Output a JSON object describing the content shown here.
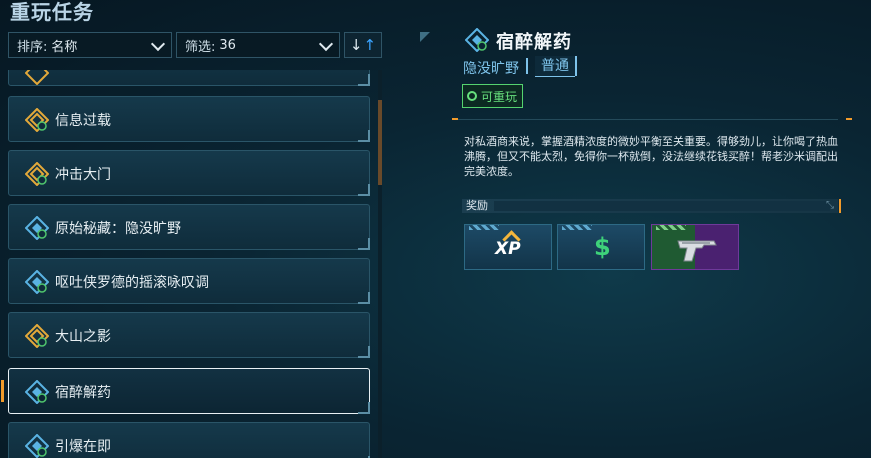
{
  "page": {
    "title": "重玩任务"
  },
  "sort": {
    "label": "排序:",
    "value": "名称"
  },
  "filter": {
    "label": "筛选:",
    "value": "36"
  },
  "sort_direction": {
    "down": "↓",
    "up": "↑"
  },
  "missions": [
    {
      "label": "信息过载",
      "icon": "gold-mission-icon",
      "selected": false
    },
    {
      "label": "冲击大门",
      "icon": "gold-mission-icon",
      "selected": false
    },
    {
      "label": "原始秘藏：隐没旷野",
      "icon": "blue-mission-icon",
      "selected": false
    },
    {
      "label": "呕吐侠罗德的摇滚咏叹调",
      "icon": "blue-mission-icon",
      "selected": false
    },
    {
      "label": "大山之影",
      "icon": "gold-mission-icon",
      "selected": false
    },
    {
      "label": "宿醉解药",
      "icon": "blue-mission-icon",
      "selected": true
    },
    {
      "label": "引爆在即",
      "icon": "blue-mission-icon",
      "selected": false
    }
  ],
  "detail": {
    "title": "宿醉解药",
    "region": "隐没旷野",
    "difficulty": "普通",
    "replayable": "可重玩",
    "description": "对私酒商来说，掌握酒精浓度的微妙平衡至关重要。得够劲儿，让你喝了热血沸腾，但又不能太烈，免得你一杯就倒，没法继续花钱买醉！帮老沙米调配出完美浓度。",
    "rewards_label": "奖励",
    "rewards": [
      {
        "type": "xp",
        "text": "XP",
        "icon": "xp-icon"
      },
      {
        "type": "money",
        "text": "$",
        "icon": "money-icon"
      },
      {
        "type": "weapon",
        "icon": "pistol-icon"
      }
    ]
  },
  "colors": {
    "accent_orange": "#f29b2b",
    "replay_green": "#67e07d",
    "tag_blue": "#7ec3ea"
  }
}
